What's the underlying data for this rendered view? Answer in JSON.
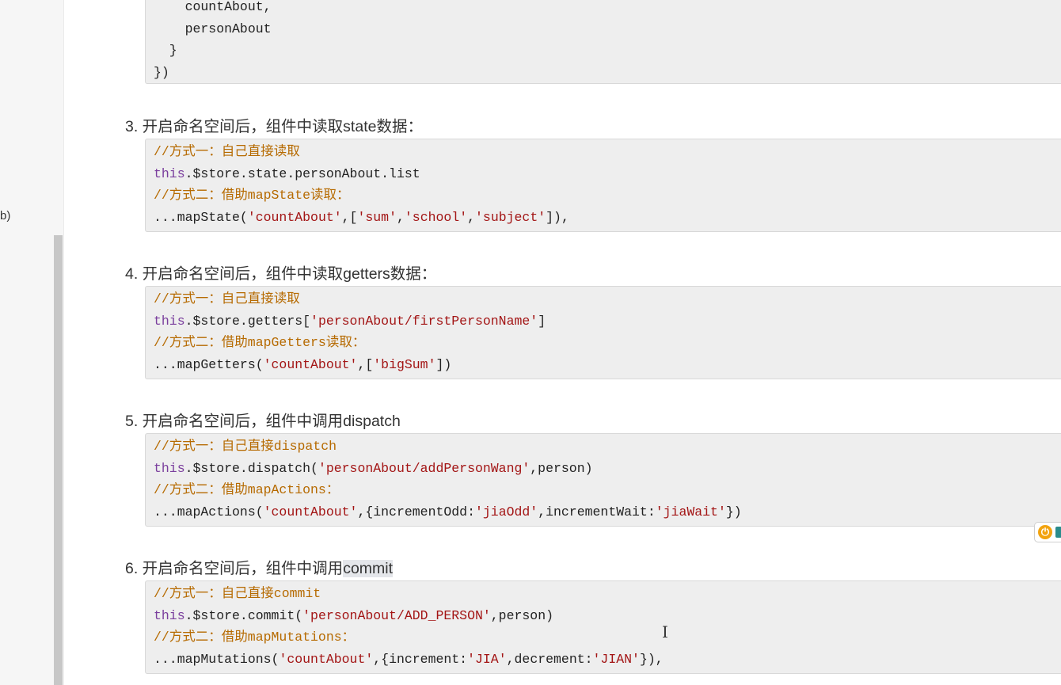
{
  "sidebar": {
    "fragment": "b)"
  },
  "block_top": {
    "lines": [
      [
        {
          "t": "pl",
          "v": "    countAbout,"
        }
      ],
      [
        {
          "t": "pl",
          "v": "    personAbout"
        }
      ],
      [
        {
          "t": "pl",
          "v": "  }"
        }
      ],
      [
        {
          "t": "pl",
          "v": "})"
        }
      ]
    ]
  },
  "headings": {
    "h3": "3. 开启命名空间后，组件中读取state数据：",
    "h4": "4. 开启命名空间后，组件中读取getters数据：",
    "h5": "5. 开启命名空间后，组件中调用dispatch",
    "h6_pre": "6. 开启命名空间后，组件中调用",
    "h6_highlight": "commit"
  },
  "block3": {
    "lines": [
      [
        {
          "t": "cm",
          "v": "//方式一：自己直接读取"
        }
      ],
      [
        {
          "t": "kw",
          "v": "this"
        },
        {
          "t": "pl",
          "v": ".$store.state.personAbout.list"
        }
      ],
      [
        {
          "t": "cm",
          "v": "//方式二：借助mapState读取："
        }
      ],
      [
        {
          "t": "pl",
          "v": "...mapState("
        },
        {
          "t": "str",
          "v": "'countAbout'"
        },
        {
          "t": "pl",
          "v": ",["
        },
        {
          "t": "str",
          "v": "'sum'"
        },
        {
          "t": "pl",
          "v": ","
        },
        {
          "t": "str",
          "v": "'school'"
        },
        {
          "t": "pl",
          "v": ","
        },
        {
          "t": "str",
          "v": "'subject'"
        },
        {
          "t": "pl",
          "v": "]),"
        }
      ]
    ]
  },
  "block4": {
    "lines": [
      [
        {
          "t": "cm",
          "v": "//方式一：自己直接读取"
        }
      ],
      [
        {
          "t": "kw",
          "v": "this"
        },
        {
          "t": "pl",
          "v": ".$store.getters["
        },
        {
          "t": "str",
          "v": "'personAbout/firstPersonName'"
        },
        {
          "t": "pl",
          "v": "]"
        }
      ],
      [
        {
          "t": "cm",
          "v": "//方式二：借助mapGetters读取："
        }
      ],
      [
        {
          "t": "pl",
          "v": "...mapGetters("
        },
        {
          "t": "str",
          "v": "'countAbout'"
        },
        {
          "t": "pl",
          "v": ",["
        },
        {
          "t": "str",
          "v": "'bigSum'"
        },
        {
          "t": "pl",
          "v": "])"
        }
      ]
    ]
  },
  "block5": {
    "lines": [
      [
        {
          "t": "cm",
          "v": "//方式一：自己直接dispatch"
        }
      ],
      [
        {
          "t": "kw",
          "v": "this"
        },
        {
          "t": "pl",
          "v": ".$store.dispatch("
        },
        {
          "t": "str",
          "v": "'personAbout/addPersonWang'"
        },
        {
          "t": "pl",
          "v": ",person)"
        }
      ],
      [
        {
          "t": "cm",
          "v": "//方式二：借助mapActions："
        }
      ],
      [
        {
          "t": "pl",
          "v": "...mapActions("
        },
        {
          "t": "str",
          "v": "'countAbout'"
        },
        {
          "t": "pl",
          "v": ",{incrementOdd:"
        },
        {
          "t": "str",
          "v": "'jiaOdd'"
        },
        {
          "t": "pl",
          "v": ",incrementWait:"
        },
        {
          "t": "str",
          "v": "'jiaWait'"
        },
        {
          "t": "pl",
          "v": "})"
        }
      ]
    ]
  },
  "block6": {
    "lines": [
      [
        {
          "t": "cm",
          "v": "//方式一：自己直接commit"
        }
      ],
      [
        {
          "t": "kw",
          "v": "this"
        },
        {
          "t": "pl",
          "v": ".$store.commit("
        },
        {
          "t": "str",
          "v": "'personAbout/ADD_PERSON'"
        },
        {
          "t": "pl",
          "v": ",person)"
        }
      ],
      [
        {
          "t": "cm",
          "v": "//方式二：借助mapMutations："
        }
      ],
      [
        {
          "t": "pl",
          "v": "...mapMutations("
        },
        {
          "t": "str",
          "v": "'countAbout'"
        },
        {
          "t": "pl",
          "v": ",{increment:"
        },
        {
          "t": "str",
          "v": "'JIA'"
        },
        {
          "t": "pl",
          "v": ",decrement:"
        },
        {
          "t": "str",
          "v": "'JIAN'"
        },
        {
          "t": "pl",
          "v": "}),"
        }
      ]
    ]
  },
  "colors": {
    "comment": "#b66a00",
    "keyword": "#7a3e9d",
    "string": "#a31515",
    "code_bg": "#eeeeee"
  },
  "icons": {
    "widget": "power-icon",
    "cursor": "text-cursor-icon"
  }
}
